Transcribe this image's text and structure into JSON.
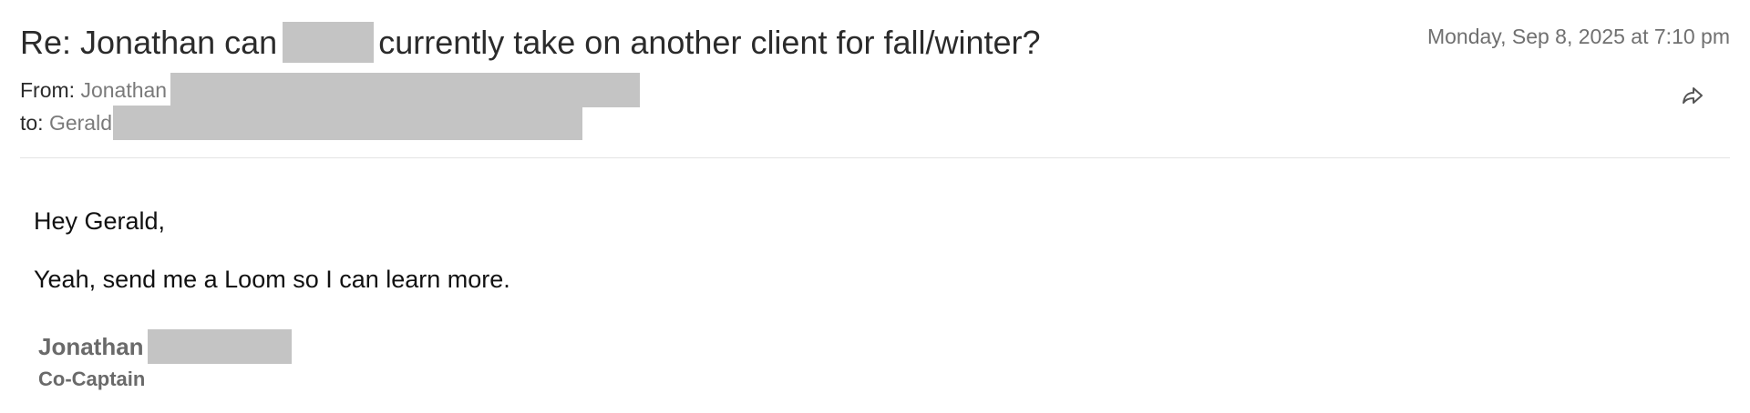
{
  "email": {
    "subject_before": "Re: Jonathan can",
    "subject_after": "currently take on another client for fall/winter?",
    "date": "Monday, Sep 8, 2025 at 7:10 pm",
    "from_label": "From:",
    "from_name": "Jonathan",
    "to_label": "to:",
    "to_name": "Gerald",
    "forward_icon": "forward-arrow-icon",
    "redaction_color": "#c4c4c4"
  },
  "body": {
    "greeting": "Hey Gerald,",
    "message": "Yeah, send me a Loom so I can learn more."
  },
  "signature": {
    "name": "Jonathan",
    "title": "Co-Captain"
  }
}
